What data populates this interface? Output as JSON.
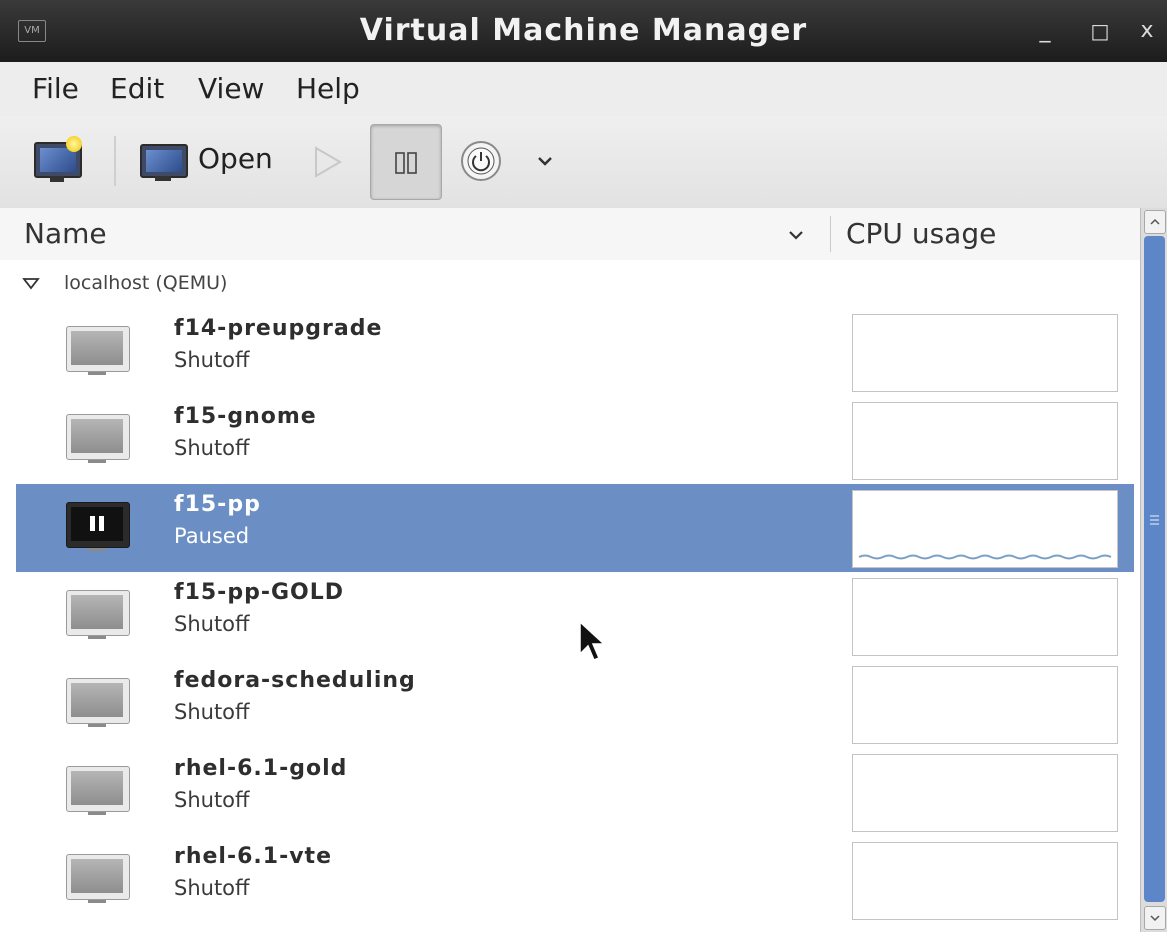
{
  "window": {
    "title": "Virtual Machine Manager",
    "app_icon_text": "VM",
    "minimize_glyph": "_",
    "maximize_glyph": "□",
    "close_glyph": "x"
  },
  "menubar": {
    "items": [
      "File",
      "Edit",
      "View",
      "Help"
    ]
  },
  "toolbar": {
    "open_label": "Open",
    "buttons": [
      "new-vm-icon",
      "open-console-icon",
      "run-icon",
      "pause-icon",
      "shutdown-icon",
      "chevron-down-icon"
    ],
    "pause_pressed": true
  },
  "columns": {
    "name": "Name",
    "cpu": "CPU usage"
  },
  "connection": {
    "label": "localhost (QEMU)",
    "expanded": true
  },
  "vms": [
    {
      "name": "f14-preupgrade",
      "state": "Shutoff",
      "selected": false
    },
    {
      "name": "f15-gnome",
      "state": "Shutoff",
      "selected": false
    },
    {
      "name": "f15-pp",
      "state": "Paused",
      "selected": true
    },
    {
      "name": "f15-pp-GOLD",
      "state": "Shutoff",
      "selected": false
    },
    {
      "name": "fedora-scheduling",
      "state": "Shutoff",
      "selected": false
    },
    {
      "name": "rhel-6.1-gold",
      "state": "Shutoff",
      "selected": false
    },
    {
      "name": "rhel-6.1-vte",
      "state": "Shutoff",
      "selected": false
    }
  ],
  "colors": {
    "selection": "#6b8fc4",
    "scrollbar_thumb": "#5c86c8",
    "titlebar": "#2a2a2a"
  }
}
